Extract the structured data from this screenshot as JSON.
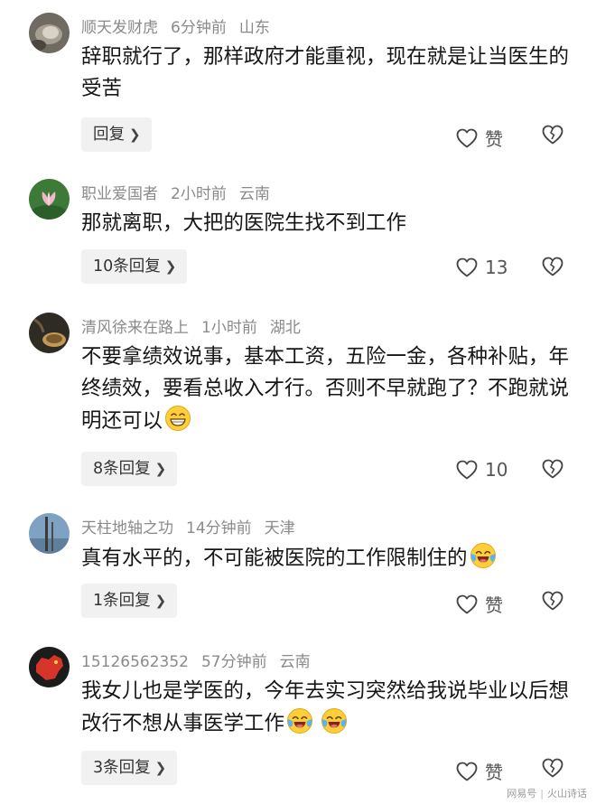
{
  "comments": [
    {
      "username": "顺天发财虎",
      "time": "6分钟前",
      "location": "山东",
      "text": "辞职就行了，那样政府才能重视，现在就是让当医生的受苦",
      "emojis": [],
      "reply_label": "回复",
      "like_label": "赞",
      "avatar_icon": "avatar-photo-icon",
      "colors": {
        "bg": "#6f6a62",
        "fg": "#d9d2c6"
      }
    },
    {
      "username": "职业爱国者",
      "time": "2小时前",
      "location": "云南",
      "text": "那就离职，大把的医院生找不到工作",
      "emojis": [],
      "reply_label": "10条回复",
      "like_label": "13",
      "avatar_icon": "lotus-avatar-icon",
      "colors": {
        "bg": "#3d7a38",
        "fg": "#f1b7c9"
      }
    },
    {
      "username": "清风徐来在路上",
      "time": "1小时前",
      "location": "湖北",
      "text": "不要拿绩效说事，基本工资，五险一金，各种补贴，年终绩效，要看总收入才行。否则不早就跑了？不跑就说明还可以",
      "emojis": [
        "grin-emoji"
      ],
      "reply_label": "8条回复",
      "like_label": "10",
      "avatar_icon": "tea-avatar-icon",
      "colors": {
        "bg": "#2e2a24",
        "fg": "#c09a56"
      }
    },
    {
      "username": "天柱地轴之功",
      "time": "14分钟前",
      "location": "天津",
      "text": "真有水平的，不可能被医院的工作限制住的",
      "emojis": [
        "cry-laugh-emoji"
      ],
      "reply_label": "1条回复",
      "like_label": "赞",
      "avatar_icon": "landscape-avatar-icon",
      "colors": {
        "bg": "#7fa2c2",
        "fg": "#3a3a3a"
      }
    },
    {
      "username": "15126562352",
      "time": "57分钟前",
      "location": "云南",
      "text": "我女儿也是学医的，今年去实习突然给我说毕业以后想改行不想从事医学工作",
      "emojis": [
        "cry-laugh-emoji",
        "cry-laugh-emoji"
      ],
      "reply_label": "3条回复",
      "like_label": "赞",
      "avatar_icon": "map-avatar-icon",
      "colors": {
        "bg": "#1c1c1c",
        "fg": "#d8352a"
      }
    }
  ],
  "watermark": {
    "left": "网易号",
    "right": "火山诗话"
  }
}
